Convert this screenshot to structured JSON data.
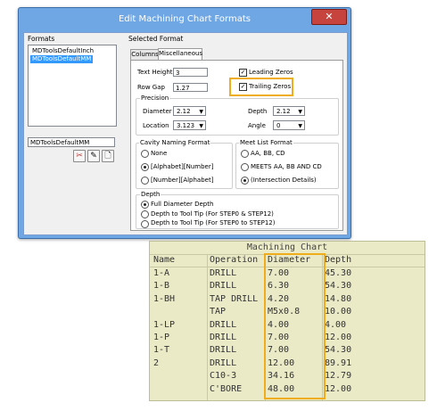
{
  "dialog": {
    "title": "Edit Machining Chart Formats",
    "close_glyph": "✕",
    "formats_label": "Formats",
    "formats_list": [
      "MDToolsDefaultInch",
      "MDToolsDefaultMM"
    ],
    "selected_list_index": 1,
    "format_name_value": "MDToolsDefaultMM",
    "selected_format_label": "Selected Format",
    "tabs": [
      "Columns",
      "Miscellaneous"
    ],
    "active_tab": "Miscellaneous",
    "text_height_label": "Text Height",
    "text_height_value": "3",
    "row_gap_label": "Row Gap",
    "row_gap_value": "1.27",
    "leading_zeros_label": "Leading Zeros",
    "leading_zeros_checked": true,
    "trailing_zeros_label": "Trailing Zeros",
    "trailing_zeros_checked": true,
    "precision": {
      "label": "Precision",
      "diameter_label": "Diameter",
      "diameter_value": "2.12",
      "depth_label": "Depth",
      "depth_value": "2.12",
      "location_label": "Location",
      "location_value": "3.123",
      "angle_label": "Angle",
      "angle_value": "0"
    },
    "cavity_naming": {
      "label": "Cavity Naming Format",
      "options": [
        "None",
        "[Alphabet][Number]",
        "[Number][Alphabet]"
      ],
      "selected": "[Alphabet][Number]"
    },
    "meet_list": {
      "label": "Meet List Format",
      "options": [
        "AA, BB, CD",
        "MEETS AA, BB AND CD",
        "(Intersection Details)"
      ],
      "selected": "(Intersection Details)"
    },
    "depth_group": {
      "label": "Depth",
      "options": [
        "Full Diameter Depth",
        "Depth to Tool Tip (For STEP0 & STEP12)",
        "Depth to Tool Tip (For STEP0 to STEP12)"
      ],
      "selected": "Full Diameter Depth"
    },
    "icons": [
      "delete-icon",
      "edit-icon",
      "new-document-icon"
    ],
    "icon_glyphs": [
      "✂",
      "✎",
      "🗋"
    ],
    "highlight_color": "#f0ad1b"
  },
  "machining_chart": {
    "title": "Machining Chart",
    "columns": [
      "Name",
      "Operation",
      "Diameter",
      "Depth"
    ],
    "rows": [
      [
        "1-A",
        "DRILL",
        "7.00",
        "45.30"
      ],
      [
        "1-B",
        "DRILL",
        "6.30",
        "54.30"
      ],
      [
        "1-BH",
        "TAP DRILL",
        "4.20",
        "14.80"
      ],
      [
        "",
        "TAP",
        "M5x0.8",
        "10.00"
      ],
      [
        "1-LP",
        "DRILL",
        "4.00",
        "4.00"
      ],
      [
        "1-P",
        "DRILL",
        "7.00",
        "12.00"
      ],
      [
        "1-T",
        "DRILL",
        "7.00",
        "54.30"
      ],
      [
        "2",
        "DRILL",
        "12.00",
        "89.91"
      ],
      [
        "",
        "C10-3",
        "34.16",
        "12.79"
      ],
      [
        "",
        "C'BORE",
        "48.00",
        "12.00"
      ]
    ],
    "background": "#eaeac7"
  }
}
